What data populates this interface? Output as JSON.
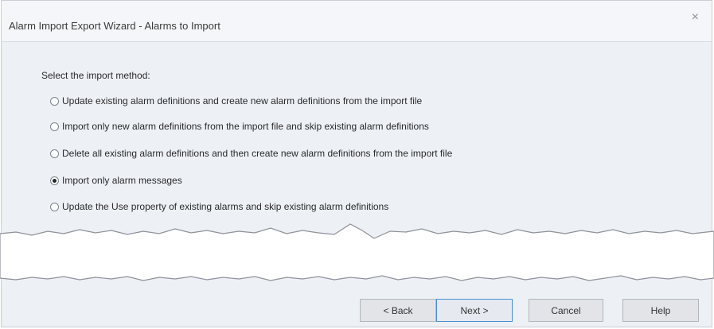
{
  "window": {
    "title": "Alarm Import Export Wizard - Alarms to Import",
    "close_glyph": "×"
  },
  "prompt": "Select the import method:",
  "options": [
    {
      "label": "Update existing alarm definitions and create new alarm definitions from the import file",
      "checked": false
    },
    {
      "label": "Import only new alarm definitions from the import file and skip existing alarm definitions",
      "checked": false
    },
    {
      "label": "Delete all existing alarm definitions and then create new alarm definitions from the import file",
      "checked": false
    },
    {
      "label": "Import only alarm messages",
      "checked": true
    },
    {
      "label": "Update the Use property of existing alarms and skip existing alarm definitions",
      "checked": false
    }
  ],
  "buttons": {
    "back": "< Back",
    "next": "Next >",
    "cancel": "Cancel",
    "help": "Help"
  },
  "colors": {
    "panel_bg": "#edf0f5",
    "default_button_border": "#4a8fd4"
  }
}
